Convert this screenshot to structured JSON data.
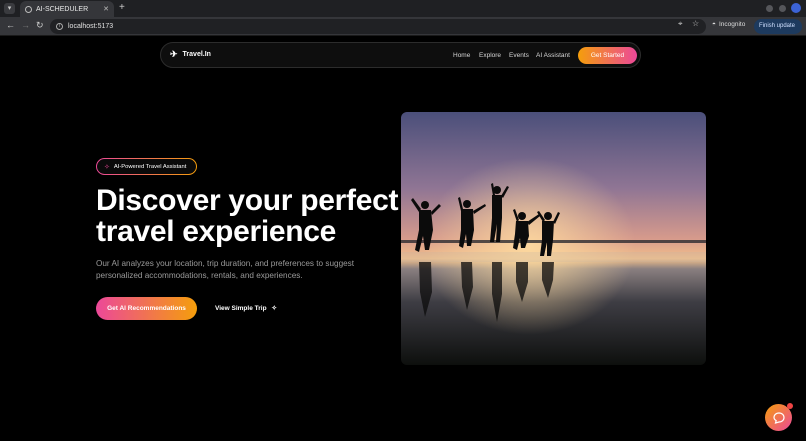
{
  "browser": {
    "tab_title": "AI-SCHEDULER",
    "new_tab": "+",
    "url": "localhost:5173",
    "incognito_label": "Incognito",
    "update_label": "Finish update"
  },
  "nav": {
    "brand": "Travel.In",
    "links": [
      "Home",
      "Explore",
      "Events",
      "AI Assistant"
    ],
    "cta": "Get Started"
  },
  "hero": {
    "badge": "AI-Powered Travel Assistant",
    "headline_line1": "Discover your perfect",
    "headline_line2": "travel experience",
    "subtext": "Our AI analyzes your location, trip duration, and preferences to suggest personalized accommodations, rentals, and experiences.",
    "primary_cta": "Get AI Recommendations",
    "secondary_cta": "View Simple Trip",
    "image_icon": "beach-sunset-silhouettes-image"
  },
  "chat": {
    "icon": "chat-icon"
  },
  "colors": {
    "accent_pink": "#ec4899",
    "accent_orange": "#f59e0b",
    "background": "#000000"
  }
}
